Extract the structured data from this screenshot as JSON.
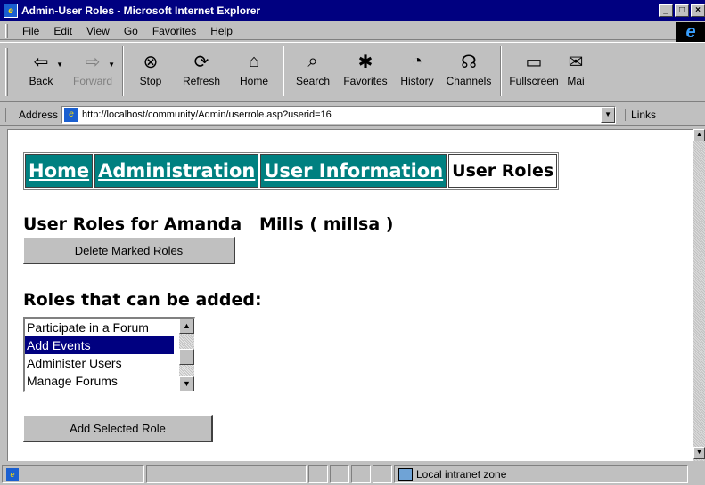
{
  "window": {
    "title": "Admin-User Roles - Microsoft Internet Explorer",
    "minimize": "_",
    "restore": "□",
    "close": "×"
  },
  "menu": [
    "File",
    "Edit",
    "View",
    "Go",
    "Favorites",
    "Help"
  ],
  "toolbar": [
    {
      "label": "Back",
      "icon": "back-arrow-icon",
      "glyph": "⇦",
      "disabled": false,
      "dropdown": true
    },
    {
      "label": "Forward",
      "icon": "forward-arrow-icon",
      "glyph": "⇨",
      "disabled": true,
      "dropdown": true
    },
    {
      "label": "Stop",
      "icon": "stop-icon",
      "glyph": "⊗",
      "disabled": false,
      "dropdown": false
    },
    {
      "label": "Refresh",
      "icon": "refresh-icon",
      "glyph": "⟳",
      "disabled": false,
      "dropdown": false
    },
    {
      "label": "Home",
      "icon": "home-icon",
      "glyph": "⌂",
      "disabled": false,
      "dropdown": false
    },
    {
      "label": "Search",
      "icon": "search-icon",
      "glyph": "⌕",
      "disabled": false,
      "dropdown": false
    },
    {
      "label": "Favorites",
      "icon": "favorites-icon",
      "glyph": "✱",
      "disabled": false,
      "dropdown": false
    },
    {
      "label": "History",
      "icon": "history-icon",
      "glyph": "◔",
      "disabled": false,
      "dropdown": false
    },
    {
      "label": "Channels",
      "icon": "channels-icon",
      "glyph": "☊",
      "disabled": false,
      "dropdown": false
    },
    {
      "label": "Fullscreen",
      "icon": "fullscreen-icon",
      "glyph": "▭",
      "disabled": false,
      "dropdown": false
    },
    {
      "label": "Mai",
      "icon": "mail-icon",
      "glyph": "✉",
      "disabled": false,
      "dropdown": false
    }
  ],
  "address": {
    "label": "Address",
    "url": "http://localhost/community/Admin/userrole.asp?userid=16",
    "links_label": "Links"
  },
  "nav": [
    {
      "label": "Home",
      "link": true
    },
    {
      "label": "Administration",
      "link": true
    },
    {
      "label": "User Information",
      "link": true
    },
    {
      "label": "User Roles",
      "link": false
    }
  ],
  "page": {
    "heading": "User Roles for Amanda   Mills ( millsa )",
    "delete_button": "Delete Marked Roles",
    "addable_heading": "Roles that can be added:",
    "roles": [
      {
        "label": "Participate in a Forum",
        "selected": false
      },
      {
        "label": "Add Events",
        "selected": true
      },
      {
        "label": "Administer Users",
        "selected": false
      },
      {
        "label": "Manage Forums",
        "selected": false
      }
    ],
    "add_button": "Add Selected Role"
  },
  "status": {
    "zone": "Local intranet zone"
  }
}
